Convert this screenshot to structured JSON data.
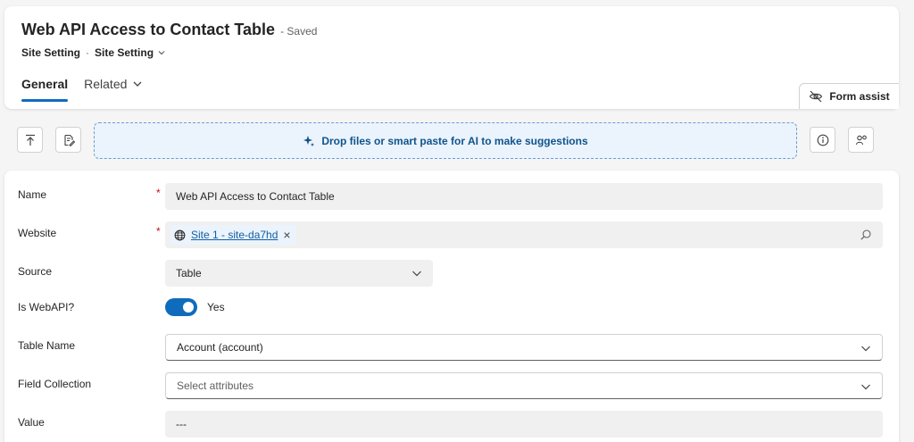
{
  "header": {
    "title": "Web API Access to Contact Table",
    "saved": "- Saved",
    "breadcrumb": {
      "entity": "Site Setting",
      "separator": "·",
      "form": "Site Setting"
    },
    "tabs": [
      {
        "label": "General"
      },
      {
        "label": "Related"
      }
    ],
    "form_assist": "Form assist"
  },
  "toolbar": {
    "dropzone_text": "Drop files or smart paste for AI to make suggestions"
  },
  "form": {
    "name": {
      "label": "Name",
      "required": "*",
      "value": "Web API Access to Contact Table"
    },
    "website": {
      "label": "Website",
      "required": "*",
      "value": "Site 1 - site-da7hd",
      "remove": "×"
    },
    "source": {
      "label": "Source",
      "value": "Table"
    },
    "is_webapi": {
      "label": "Is WebAPI?",
      "value": "Yes",
      "on": true
    },
    "table_name": {
      "label": "Table Name",
      "value": "Account (account)"
    },
    "field_collection": {
      "label": "Field Collection",
      "placeholder": "Select attributes"
    },
    "value": {
      "label": "Value",
      "value": "---"
    }
  },
  "colors": {
    "accent": "#0f6cbd",
    "required": "#c50f1f",
    "dropzone_bg": "#ebf3fc"
  }
}
